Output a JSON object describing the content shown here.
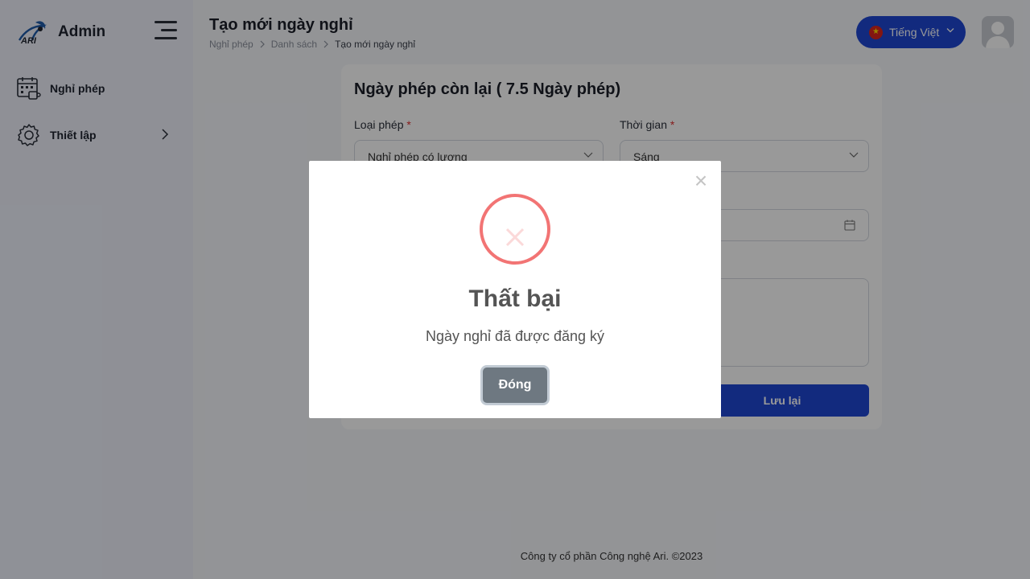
{
  "sidebar": {
    "app_name": "Admin",
    "items": [
      {
        "label": "Nghỉ phép"
      },
      {
        "label": "Thiết lập"
      }
    ]
  },
  "header": {
    "title": "Tạo mới ngày nghỉ",
    "breadcrumb": [
      "Nghỉ phép",
      "Danh sách",
      "Tạo mới ngày nghỉ"
    ],
    "language": "Tiếng Việt"
  },
  "form": {
    "title": "Ngày phép còn lại ( 7.5 Ngày phép)",
    "leave_type_label": "Loại phép",
    "leave_type_value": "Nghỉ phép có lương",
    "time_label": "Thời gian",
    "time_value": "Sáng",
    "required_mark": "*",
    "save_label": "Lưu lại"
  },
  "footer": {
    "text": "Công ty cổ phần Công nghệ Ari. ©2023"
  },
  "modal": {
    "title": "Thất bại",
    "message": "Ngày nghỉ đã được đăng ký",
    "close_button": "Đóng",
    "close_icon": "×"
  },
  "colors": {
    "primary": "#1e46d2",
    "error": "#f27474",
    "modal_button": "#6e7881",
    "overlay": "rgba(0,0,0,0.4)"
  }
}
